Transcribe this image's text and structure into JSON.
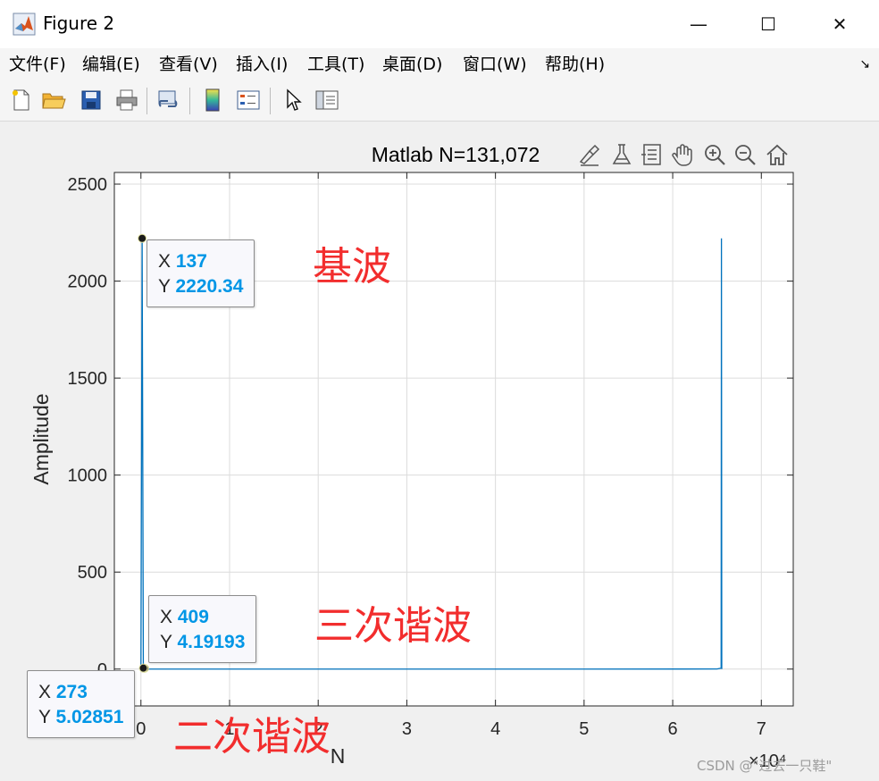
{
  "window": {
    "title": "Figure 2",
    "controls": [
      "—",
      "☐",
      "✕"
    ]
  },
  "menu": [
    "文件(F)",
    "编辑(E)",
    "查看(V)",
    "插入(I)",
    "工具(T)",
    "桌面(D)",
    "窗口(W)",
    "帮助(H)"
  ],
  "menu_corner": "↘",
  "toolbar": [
    "new-icon",
    "open-icon",
    "save-icon",
    "print-icon",
    "link-icon",
    "colorbar-icon",
    "legend-icon",
    "pointer-icon",
    "property-icon"
  ],
  "axes_toolbar": [
    "brush-icon",
    "data-cursor-icon",
    "legend-toggle-icon",
    "pan-icon",
    "zoom-in-icon",
    "zoom-out-icon",
    "home-icon"
  ],
  "chart_data": {
    "type": "line",
    "title": "Matlab N=131,072",
    "xlabel": "N",
    "ylabel": "Amplitude",
    "x_exponent_label": "×10⁴",
    "xlim": [
      -0.3,
      7.36
    ],
    "ylim": [
      -190,
      2560
    ],
    "xticks": [
      0,
      1,
      2,
      3,
      4,
      5,
      6,
      7
    ],
    "xtick_labels": [
      "0",
      "1",
      "2",
      "3",
      "4",
      "5",
      "6",
      "7"
    ],
    "yticks": [
      0,
      500,
      1000,
      1500,
      2000,
      2500
    ],
    "ytick_labels": [
      "0",
      "500",
      "1000",
      "1500",
      "2000",
      "2500"
    ],
    "grid": true,
    "series_color": "#0072bd",
    "series": [
      {
        "x": [
          0,
          0.0137,
          0.0273,
          0.0409,
          0.08,
          1.0,
          3.0,
          5.0,
          6.5,
          6.5395,
          6.5463,
          6.5499,
          6.5536
        ],
        "y": [
          0,
          2220.34,
          5.02851,
          4.19193,
          0.4,
          0.1,
          0.05,
          0.1,
          0.5,
          4.19193,
          5.02851,
          2220.34,
          0
        ]
      }
    ],
    "datatips": [
      {
        "x_label": "X",
        "x_value": "137",
        "y_label": "Y",
        "y_value": "2220.34",
        "point": [
          0.0137,
          2220.34
        ]
      },
      {
        "x_label": "X",
        "x_value": "409",
        "y_label": "Y",
        "y_value": "4.19193",
        "point": [
          0.0409,
          4.19193
        ]
      },
      {
        "x_label": "X",
        "x_value": "273",
        "y_label": "Y",
        "y_value": "5.02851",
        "point": [
          0.0273,
          5.02851
        ]
      }
    ]
  },
  "annotations": [
    "基波",
    "三次谐波",
    "二次谐波"
  ],
  "annotation_color": "#f22d2d",
  "watermark": "CSDN @\"过去一只鞋\""
}
